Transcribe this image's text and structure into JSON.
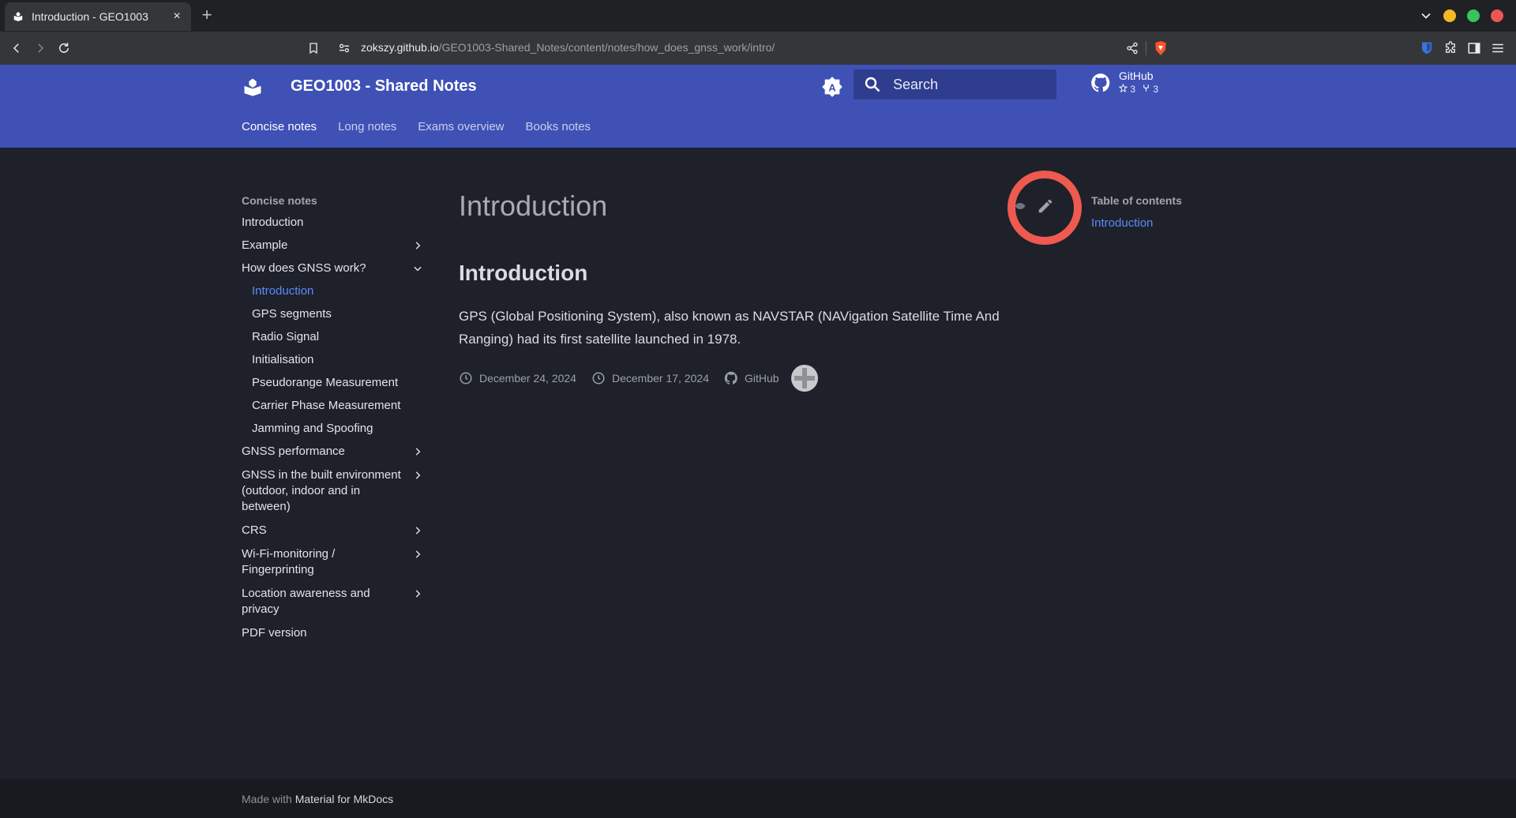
{
  "browser": {
    "tab_title": "Introduction - GEO1003",
    "tab_close": "×",
    "new_tab": "+",
    "url_host": "zokszy.github.io",
    "url_path": "/GEO1003-Shared_Notes/content/notes/how_does_gnss_work/intro/",
    "window_colors": {
      "minimize": "#f5b722",
      "maximize": "#39c35d",
      "close": "#ee5555"
    }
  },
  "header": {
    "site_title": "GEO1003 - Shared Notes",
    "search_placeholder": "Search",
    "repo": {
      "name": "GitHub",
      "stars": "3",
      "forks": "3"
    },
    "nav": [
      "Concise notes",
      "Long notes",
      "Exams overview",
      "Books notes"
    ],
    "brand_color": "#3f51b5"
  },
  "sidebar": {
    "title": "Concise notes",
    "items": [
      {
        "label": "Introduction",
        "expandable": false
      },
      {
        "label": "Example",
        "expandable": true
      },
      {
        "label": "How does GNSS work?",
        "expandable": true,
        "expanded": true
      },
      {
        "label": "GNSS performance",
        "expandable": true
      },
      {
        "label": "GNSS in the built environment (outdoor, indoor and in between)",
        "expandable": true
      },
      {
        "label": "CRS",
        "expandable": true
      },
      {
        "label": "Wi-Fi-monitoring / Fingerprinting",
        "expandable": true
      },
      {
        "label": "Location awareness and privacy",
        "expandable": true
      },
      {
        "label": "PDF version",
        "expandable": false
      }
    ],
    "subitems": [
      "Introduction",
      "GPS segments",
      "Radio Signal",
      "Initialisation",
      "Pseudorange Measurement",
      "Carrier Phase Measurement",
      "Jamming and Spoofing"
    ],
    "active_subitem": "Introduction"
  },
  "content": {
    "h1": "Introduction",
    "h2": "Introduction",
    "paragraph": "GPS (Global Positioning System), also known as NAVSTAR (NAVigation Satellite Time And Ranging) had its first satellite launched in 1978.",
    "updated": "December 24, 2024",
    "created": "December 17, 2024",
    "source": "GitHub"
  },
  "toc": {
    "title": "Table of contents",
    "links": [
      "Introduction"
    ]
  },
  "footer": {
    "prefix": "Made with",
    "link": "Material for MkDocs"
  }
}
